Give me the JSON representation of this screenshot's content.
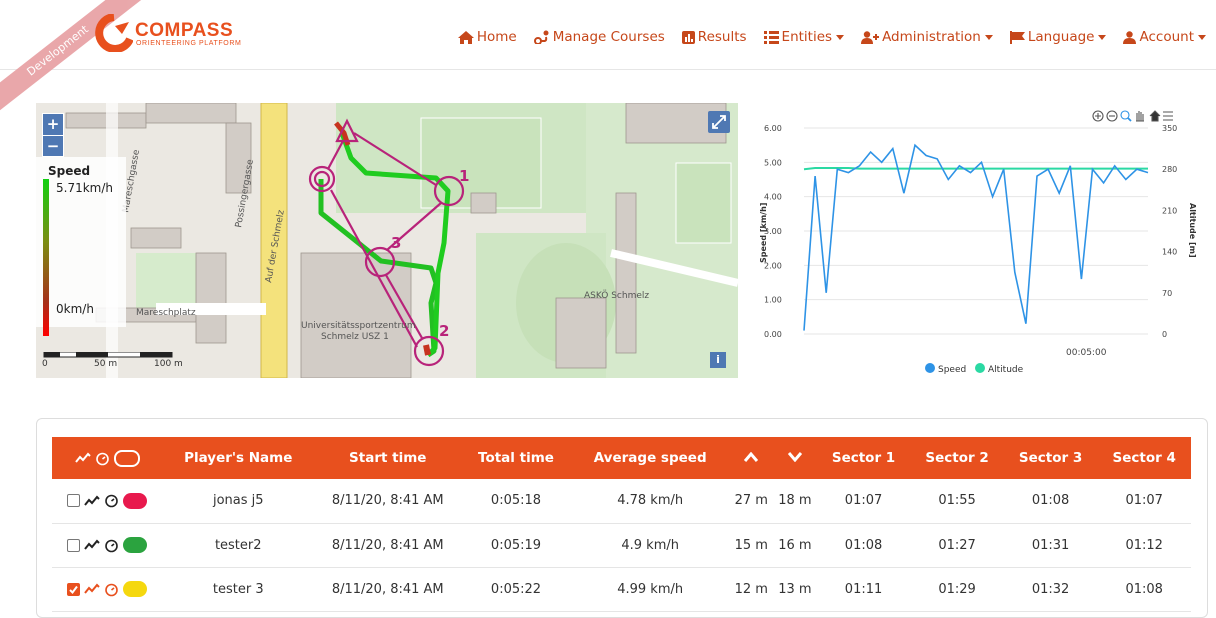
{
  "app": {
    "name": "COMPASS",
    "subtitle": "ORIENTEERING PLATFORM",
    "env_ribbon": "Development"
  },
  "nav": {
    "items": [
      {
        "label": "Home",
        "icon": "home-icon",
        "dropdown": false
      },
      {
        "label": "Manage Courses",
        "icon": "route-icon",
        "dropdown": false
      },
      {
        "label": "Results",
        "icon": "bar-chart-icon",
        "dropdown": false
      },
      {
        "label": "Entities",
        "icon": "list-icon",
        "dropdown": true
      },
      {
        "label": "Administration",
        "icon": "user-plus-icon",
        "dropdown": true
      },
      {
        "label": "Language",
        "icon": "flag-icon",
        "dropdown": true
      },
      {
        "label": "Account",
        "icon": "user-icon",
        "dropdown": true
      }
    ]
  },
  "map": {
    "legend_title": "Speed",
    "legend_max": "5.71km/h",
    "legend_min": "0km/h",
    "zoom_in": "+",
    "zoom_out": "−",
    "info": "i",
    "scale_labels": [
      "0",
      "50 m",
      "100 m"
    ],
    "streets": [
      "Mareschgasse",
      "Possingergasse",
      "Auf der Schmelz",
      "Mareschplatz",
      "Universitätssportzentrum Schmelz USZ 1",
      "ASKÖ Schmelz"
    ],
    "controls": [
      "1",
      "2",
      "3"
    ],
    "accent": "#b8237a"
  },
  "chart_data": {
    "type": "line",
    "y_left": {
      "label": "Speed [km/h]",
      "ticks": [
        "6.00",
        "5.00",
        "4.00",
        "3.00",
        "2.00",
        "1.00",
        "0.00"
      ],
      "range": [
        0,
        6
      ]
    },
    "y_right": {
      "label": "Altitude [m]",
      "ticks": [
        "350",
        "280",
        "210",
        "140",
        "70",
        "0"
      ],
      "range": [
        0,
        350
      ]
    },
    "x_ticks": [
      "00:05:00"
    ],
    "toolbar_icons": [
      "zoom-in-icon",
      "zoom-out-icon",
      "magnifier-icon",
      "pan-hand-icon",
      "reset-home-icon",
      "menu-icon"
    ],
    "series": [
      {
        "name": "Speed",
        "color": "#2e93e6",
        "values": [
          0.1,
          4.6,
          1.2,
          4.8,
          4.7,
          4.9,
          5.3,
          5.0,
          5.4,
          4.1,
          5.5,
          5.2,
          5.1,
          4.5,
          4.9,
          4.7,
          5.0,
          4.0,
          4.8,
          1.8,
          0.3,
          4.6,
          4.8,
          4.1,
          4.9,
          1.6,
          4.8,
          4.4,
          4.9,
          4.5,
          4.8,
          4.7
        ]
      },
      {
        "name": "Altitude",
        "color": "#2bd9a3",
        "values": [
          280,
          282,
          282,
          282,
          282,
          281,
          281,
          281,
          281,
          281,
          281,
          281,
          281,
          281,
          281,
          281,
          281,
          281,
          281,
          281,
          281,
          281,
          281,
          281,
          281,
          281,
          281,
          281,
          281,
          281,
          281,
          281
        ]
      }
    ],
    "legend": [
      "Speed",
      "Altitude"
    ]
  },
  "table": {
    "headers": [
      "Player's Name",
      "Start time",
      "Total time",
      "Average speed",
      "",
      "",
      "Sector 1",
      "Sector 2",
      "Sector 3",
      "Sector 4"
    ],
    "rows": [
      {
        "checked": false,
        "color": "#e8194d",
        "name": "jonas j5",
        "start": "8/11/20, 8:41 AM",
        "total": "0:05:18",
        "avg": "4.78 km/h",
        "up": "27 m",
        "down": "18 m",
        "s1": "01:07",
        "s2": "01:55",
        "s3": "01:08",
        "s4": "01:07"
      },
      {
        "checked": false,
        "color": "#2ba33f",
        "name": "tester2",
        "start": "8/11/20, 8:41 AM",
        "total": "0:05:19",
        "avg": "4.9 km/h",
        "up": "15 m",
        "down": "16 m",
        "s1": "01:08",
        "s2": "01:27",
        "s3": "01:31",
        "s4": "01:12"
      },
      {
        "checked": true,
        "color": "#f5d80f",
        "name": "tester 3",
        "start": "8/11/20, 8:41 AM",
        "total": "0:05:22",
        "avg": "4.99 km/h",
        "up": "12 m",
        "down": "13 m",
        "s1": "01:11",
        "s2": "01:29",
        "s3": "01:32",
        "s4": "01:08"
      }
    ]
  },
  "colors": {
    "brand": "#e8501e",
    "nav": "#c6471a",
    "map_button": "#4f78b3"
  }
}
